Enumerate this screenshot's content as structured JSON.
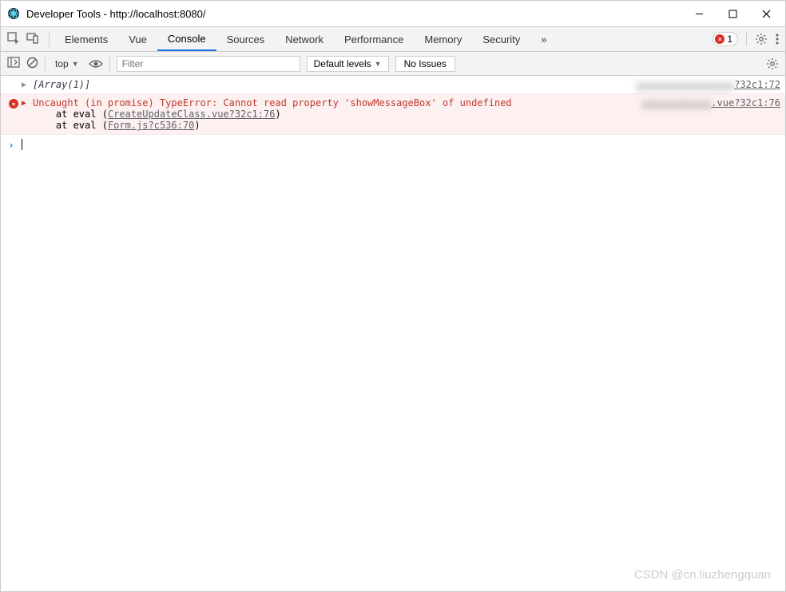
{
  "window": {
    "title": "Developer Tools - http://localhost:8080/"
  },
  "tabs": {
    "items": [
      "Elements",
      "Vue",
      "Console",
      "Sources",
      "Network",
      "Performance",
      "Memory",
      "Security"
    ],
    "active": "Console",
    "error_count": "1"
  },
  "filter": {
    "context": "top",
    "filter_placeholder": "Filter",
    "levels": "Default levels",
    "issues": "No Issues"
  },
  "console": {
    "log1": {
      "msg": "[Array(1)]",
      "src_blur": "xxxxxxxxxxxxxxxxx",
      "src": "?32c1:72"
    },
    "err": {
      "line1": "Uncaught (in promise) TypeError: Cannot read property 'showMessageBox' of undefined",
      "trace1_pre": "    at eval (",
      "trace1_link": "CreateUpdateClass.vue?32c1:76",
      "trace1_post": ")",
      "trace2_pre": "    at eval (",
      "trace2_link": "Form.js?c536:70",
      "trace2_post": ")",
      "src_blur": "xxxxxxxxxxxx",
      "src": ".vue?32c1:76"
    }
  },
  "watermark": "CSDN @cn.liuzhengquan"
}
